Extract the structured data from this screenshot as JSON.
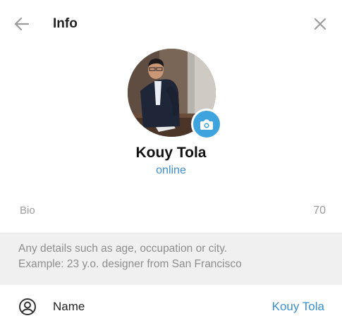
{
  "header": {
    "title": "Info",
    "back_icon": "arrow-left-icon",
    "close_icon": "close-icon"
  },
  "profile": {
    "name": "Kouy Tola",
    "status": "online",
    "status_color": "#3a8fd0",
    "camera_icon": "camera-icon",
    "camera_color": "#3fa3dd"
  },
  "bio": {
    "label": "Bio",
    "remaining": "70",
    "hint_line1": "Any details such as age, occupation or city.",
    "hint_line2": "Example: 23 y.o. designer from San Francisco"
  },
  "name_field": {
    "label": "Name",
    "value": "Kouy Tola",
    "icon": "user-circle-icon"
  },
  "colors": {
    "accent": "#3a8fd0",
    "hint_background": "#f0f0f0"
  }
}
